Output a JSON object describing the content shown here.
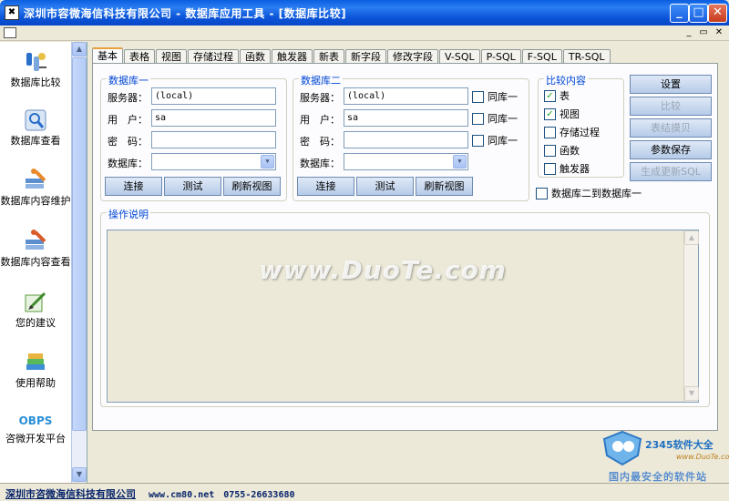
{
  "window": {
    "icon_glyph": "✖",
    "title": "深圳市容微海信科技有限公司 - 数据库应用工具 - [数据库比较]",
    "minimize": "_",
    "maximize": "□",
    "close": "✕"
  },
  "mdi": {
    "minimize": "_",
    "restore": "▭",
    "close": "✕"
  },
  "sidebar": {
    "items": [
      {
        "label": "数据库比较",
        "icon": "db-compare-icon"
      },
      {
        "label": "数据库查看",
        "icon": "db-view-icon"
      },
      {
        "label": "数据库内容维护",
        "icon": "db-maintain-icon"
      },
      {
        "label": "数据库内容查看",
        "icon": "db-content-view-icon"
      },
      {
        "label": "您的建议",
        "icon": "suggestion-icon"
      },
      {
        "label": "使用帮助",
        "icon": "help-icon"
      },
      {
        "label": "咨微开发平台",
        "icon": "obps-icon",
        "logo_text": "OBPS"
      }
    ],
    "scroll_up": "▲",
    "scroll_down": "▼"
  },
  "tabs": [
    {
      "label": "基本",
      "active": true
    },
    {
      "label": "表格"
    },
    {
      "label": "视图"
    },
    {
      "label": "存储过程"
    },
    {
      "label": "函数"
    },
    {
      "label": "触发器"
    },
    {
      "label": "新表"
    },
    {
      "label": "新字段"
    },
    {
      "label": "修改字段"
    },
    {
      "label": "V-SQL"
    },
    {
      "label": "P-SQL"
    },
    {
      "label": "F-SQL"
    },
    {
      "label": "TR-SQL"
    }
  ],
  "db1": {
    "legend": "数据库一",
    "server_label": "服务器：",
    "server_value": "(local)",
    "user_label": "用　户：",
    "user_value": "sa",
    "password_label": "密　码：",
    "password_value": "",
    "database_label": "数据库：",
    "database_value": "",
    "connect": "连接",
    "test": "测试",
    "refresh": "刷新视图"
  },
  "db2": {
    "legend": "数据库二",
    "server_label": "服务器：",
    "server_value": "(local)",
    "user_label": "用　户：",
    "user_value": "sa",
    "password_label": "密　码：",
    "password_value": "",
    "database_label": "数据库：",
    "database_value": "",
    "connect": "连接",
    "test": "测试",
    "refresh": "刷新视图",
    "same1_server": "同库一",
    "same1_user": "同库一",
    "same1_password": "同库一"
  },
  "compare": {
    "legend": "比较内容",
    "options": [
      {
        "label": "表",
        "checked": true
      },
      {
        "label": "视图",
        "checked": true
      },
      {
        "label": "存储过程",
        "checked": false
      },
      {
        "label": "函数",
        "checked": false
      },
      {
        "label": "触发器",
        "checked": false
      }
    ],
    "db2_to_db1": "数据库二到数据库一"
  },
  "actions": {
    "settings": "设置",
    "compare": "比较",
    "export_table": "表结摸贝",
    "save_params": "参数保存",
    "generate_sql": "生成更新SQL"
  },
  "description": {
    "legend": "操作说明",
    "content": ""
  },
  "watermark": "www.DuoTe.com",
  "status": {
    "company": "深圳市咨微海信科技有限公司",
    "website_phone": "www.cm80.net　0755-26633680"
  },
  "badge": {
    "title": "2345软件大全",
    "url": "www.DuoTe.com",
    "slogan": "国内最安全的软件站"
  },
  "colors": {
    "titlebar": "#0a5fe0",
    "group_legend": "#0046d5",
    "check_mark": "#21a121"
  }
}
